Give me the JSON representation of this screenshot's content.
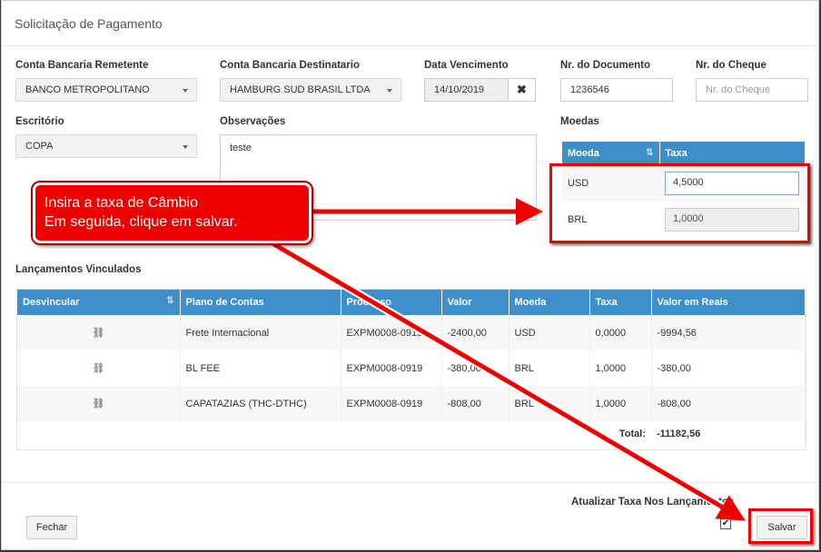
{
  "dialog": {
    "title": "Solicitação de Pagamento"
  },
  "form": {
    "conta_remetente": {
      "label": "Conta Bancaria Remetente",
      "value": "BANCO METROPOLITANO"
    },
    "conta_destinataria": {
      "label": "Conta Bancaria Destinatario",
      "value": "HAMBURG SUD BRASIL LTDA"
    },
    "data_vencimento": {
      "label": "Data Vencimento",
      "value": "14/10/2019"
    },
    "nr_documento": {
      "label": "Nr. do Documento",
      "value": "1236546"
    },
    "nr_cheque": {
      "label": "Nr. do Cheque",
      "placeholder": "Nr. do Cheque"
    },
    "escritorio": {
      "label": "Escritório",
      "value": "COPA"
    },
    "observacoes": {
      "label": "Observações",
      "value": "teste"
    }
  },
  "moedas": {
    "label": "Moedas",
    "headers": [
      "Moeda",
      "Taxa"
    ],
    "rows": [
      {
        "moeda": "USD",
        "taxa": "4,5000"
      },
      {
        "moeda": "BRL",
        "taxa": "1,0000"
      }
    ]
  },
  "lancamentos": {
    "label": "Lançamentos Vinculados",
    "headers": [
      "Desvincular",
      "Plano de Contas",
      "Processo",
      "Valor",
      "Moeda",
      "Taxa",
      "Valor em Reais"
    ],
    "rows": [
      {
        "plano": "Frete Internacional",
        "processo": "EXPM0008-0919",
        "valor": "-2400,00",
        "moeda": "USD",
        "taxa": "0,0000",
        "reais": "-9994,56"
      },
      {
        "plano": "BL FEE",
        "processo": "EXPM0008-0919",
        "valor": "-380,00",
        "moeda": "BRL",
        "taxa": "1,0000",
        "reais": "-380,00"
      },
      {
        "plano": "CAPATAZIAS (THC-DTHC)",
        "processo": "EXPM0008-0919",
        "valor": "-808,00",
        "moeda": "BRL",
        "taxa": "1,0000",
        "reais": "-808,00"
      }
    ],
    "total_label": "Total:",
    "total_value": "-11182,56"
  },
  "footer": {
    "fechar": "Fechar",
    "salvar": "Salvar",
    "atualizar_label": "Atualizar Taxa Nos Lançamentos",
    "atualizar_checked": true
  },
  "annotation": {
    "line1": "Insira a taxa de Câmbio",
    "line2": "Em seguida, clique em salvar."
  },
  "icons": {
    "caret": "chevron-down-icon",
    "clear": "close-icon",
    "sort": "sort-icon",
    "unlink": "unlink-icon"
  },
  "colors": {
    "header_blue": "#3d8ec9",
    "annotation_red": "#ee0000"
  }
}
